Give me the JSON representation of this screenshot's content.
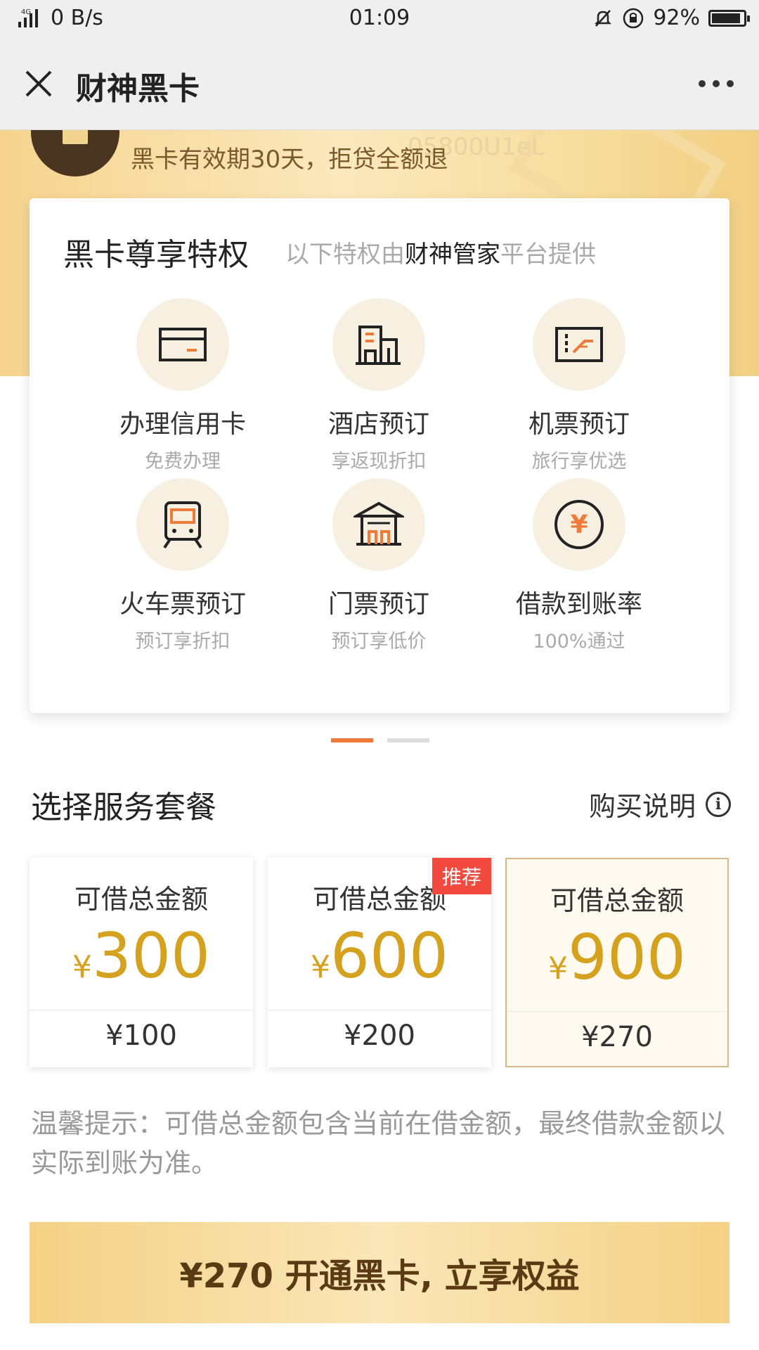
{
  "status_bar": {
    "network": "4G",
    "speed": "0 B/s",
    "time": "01:09",
    "battery": "92%",
    "battery_level": 0.92
  },
  "header": {
    "title": "财神黑卡"
  },
  "hero": {
    "text": "黑卡有效期30天，拒贷全额退",
    "watermark": "05800U1eL"
  },
  "privileges": {
    "title": "黑卡尊享特权",
    "subtitle_prefix": "以下特权由",
    "subtitle_highlight": "财神管家",
    "subtitle_suffix": "平台提供",
    "items": [
      {
        "title": "办理信用卡",
        "sub": "免费办理",
        "icon": "credit-card-icon"
      },
      {
        "title": "酒店预订",
        "sub": "享返现折扣",
        "icon": "hotel-icon"
      },
      {
        "title": "机票预订",
        "sub": "旅行享优选",
        "icon": "flight-ticket-icon"
      },
      {
        "title": "火车票预订",
        "sub": "预订享折扣",
        "icon": "train-icon"
      },
      {
        "title": "门票预订",
        "sub": "预订享低价",
        "icon": "attraction-icon"
      },
      {
        "title": "借款到账率",
        "sub": "100%通过",
        "icon": "yen-coin-icon"
      }
    ]
  },
  "plans_section": {
    "title": "选择服务套餐",
    "buy_note": "购买说明"
  },
  "plans": [
    {
      "label": "可借总金额",
      "currency": "¥",
      "amount": "300",
      "price": "¥100",
      "tag": "",
      "selected": false
    },
    {
      "label": "可借总金额",
      "currency": "¥",
      "amount": "600",
      "price": "¥200",
      "tag": "推荐",
      "selected": false
    },
    {
      "label": "可借总金额",
      "currency": "¥",
      "amount": "900",
      "price": "¥270",
      "tag": "",
      "selected": true
    }
  ],
  "tip": "温馨提示：可借总金额包含当前在借金额，最终借款金额以实际到账为准。",
  "cta": {
    "label": "¥270 开通黑卡, 立享权益"
  },
  "colors": {
    "gold": "#d4a21e",
    "accent_orange": "#f07a3a",
    "tag_red": "#f24a3f"
  }
}
